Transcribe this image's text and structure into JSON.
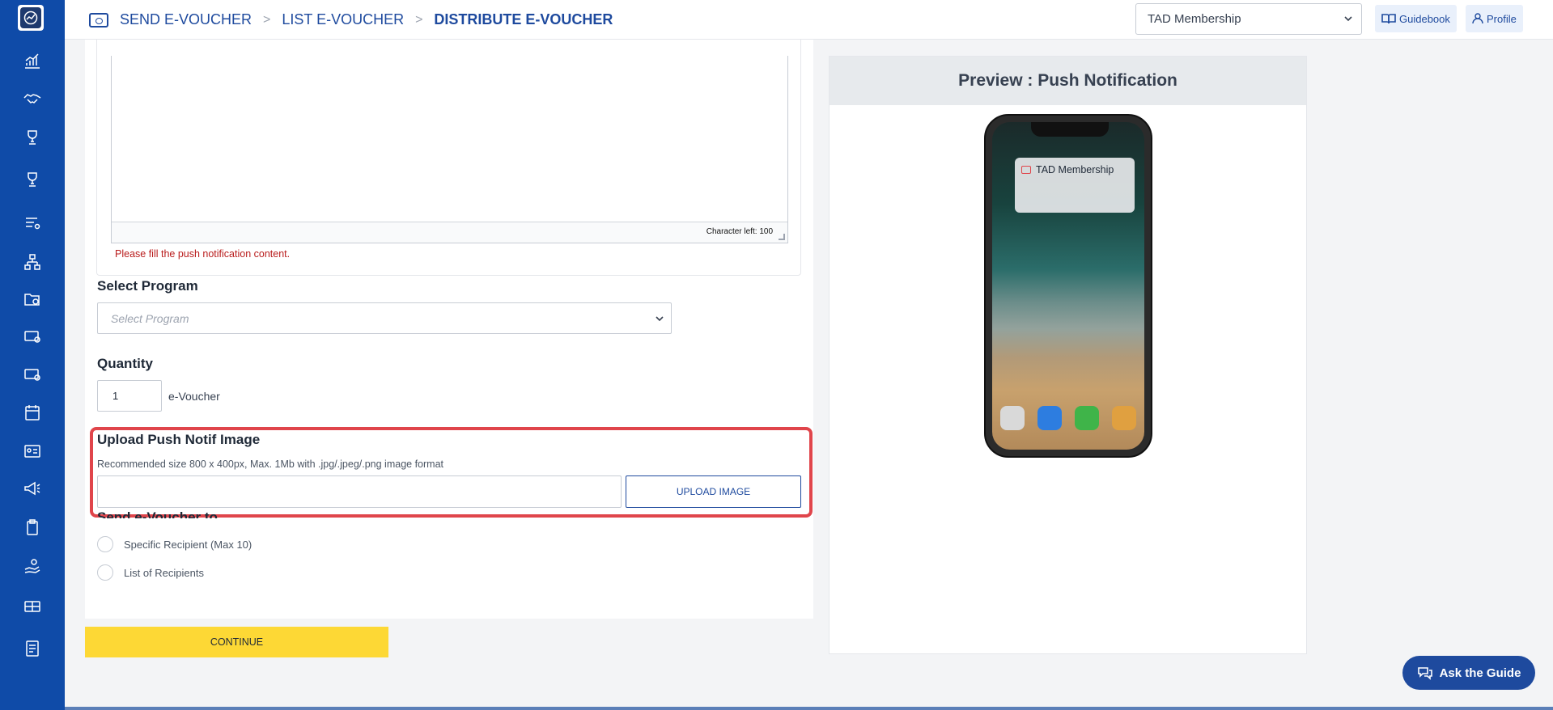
{
  "breadcrumb": {
    "items": [
      "SEND E-VOUCHER",
      "LIST E-VOUCHER",
      "DISTRIBUTE E-VOUCHER"
    ],
    "separator": ">"
  },
  "topbar": {
    "organization_select": "TAD Membership",
    "guidebook_label": "Guidebook",
    "profile_label": "Profile"
  },
  "form": {
    "char_left_label": "Character left: 100",
    "error_message": "Please fill the push notification content.",
    "program_label": "Select Program",
    "program_placeholder": "Select Program",
    "quantity_label": "Quantity",
    "quantity_value": "1",
    "quantity_unit": "e-Voucher",
    "upload_label": "Upload Push Notif Image",
    "upload_hint": "Recommended size 800 x 400px, Max. 1Mb with .jpg/.jpeg/.png image format",
    "upload_button": "UPLOAD IMAGE",
    "send_to_label": "Send e-Voucher to",
    "recipient_options": [
      "Specific Recipient (Max 10)",
      "List of Recipients"
    ],
    "continue_button": "CONTINUE"
  },
  "preview": {
    "title": "Preview : Push Notification",
    "notification_app": "TAD Membership"
  },
  "help": {
    "ask_label": "Ask the Guide"
  },
  "colors": {
    "sidebar": "#0f4ba8",
    "primary": "#1e4a9e",
    "continue": "#fdd835",
    "highlight": "#e0454b",
    "error": "#b91c1c"
  },
  "sidebar_icons": [
    "chart-icon",
    "handshake-icon",
    "trophy-icon",
    "trophy-alt-icon",
    "list-settings-icon",
    "hierarchy-icon",
    "folder-clock-icon",
    "voucher-settings-icon",
    "voucher-clock-icon",
    "calendar-icon",
    "id-card-icon",
    "megaphone-icon",
    "clipboard-icon",
    "hand-coins-icon",
    "gift-card-icon",
    "document-icon"
  ]
}
